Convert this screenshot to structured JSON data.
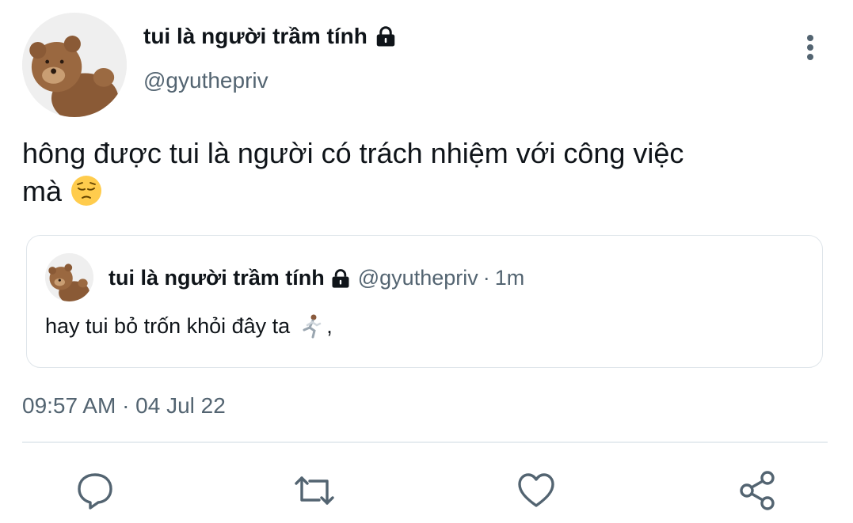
{
  "tweet": {
    "author": {
      "display_name": "tui là người trầm tính",
      "handle": "@gyuthepriv",
      "avatar_icon": "teddy-bear-avatar",
      "protected_icon": "lock-icon"
    },
    "text_line1": "hông được tui là người có trách nhiệm với công việc",
    "text_line2": "mà",
    "emoji_icon": "pensive-face-emoji",
    "timestamp": "09:57 AM · 04 Jul 22",
    "more_icon": "more-vertical-icon"
  },
  "quoted_tweet": {
    "display_name": "tui là người trầm tính",
    "handle": "@gyuthepriv",
    "separator": "·",
    "time_ago": "1m",
    "text": "hay tui bỏ trốn khỏi đây ta",
    "emoji_icon": "running-person-emoji",
    "trailing": ","
  },
  "actions": [
    {
      "name": "reply",
      "icon": "reply-icon"
    },
    {
      "name": "retweet",
      "icon": "retweet-icon"
    },
    {
      "name": "like",
      "icon": "heart-icon"
    },
    {
      "name": "share",
      "icon": "share-icon"
    }
  ],
  "colors": {
    "text": "#0f1419",
    "secondary": "#536471",
    "border": "#dfe5ea"
  }
}
